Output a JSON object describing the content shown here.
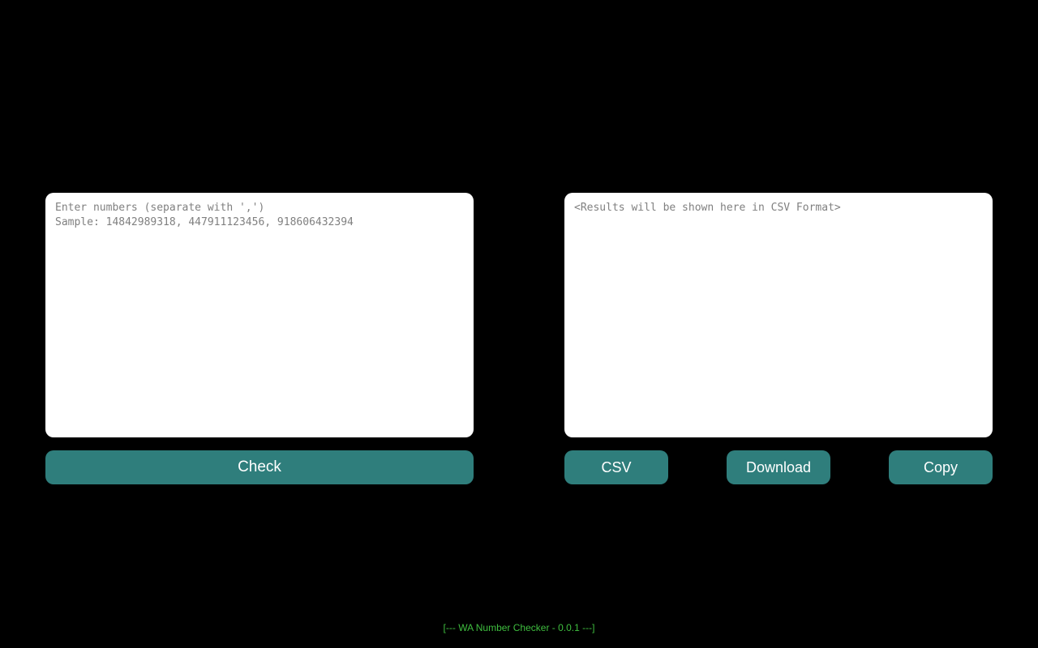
{
  "input": {
    "placeholder": "Enter numbers (separate with ',')\nSample: 14842989318, 447911123456, 918606432394",
    "check_label": "Check"
  },
  "output": {
    "placeholder": "<Results will be shown here in CSV Format>",
    "csv_label": "CSV",
    "download_label": "Download",
    "copy_label": "Copy"
  },
  "footer": {
    "text": "[--- WA Number Checker - 0.0.1 ---]"
  },
  "colors": {
    "button": "#2f7e7c",
    "footer_text": "#3fbe3f",
    "background": "#000000"
  }
}
